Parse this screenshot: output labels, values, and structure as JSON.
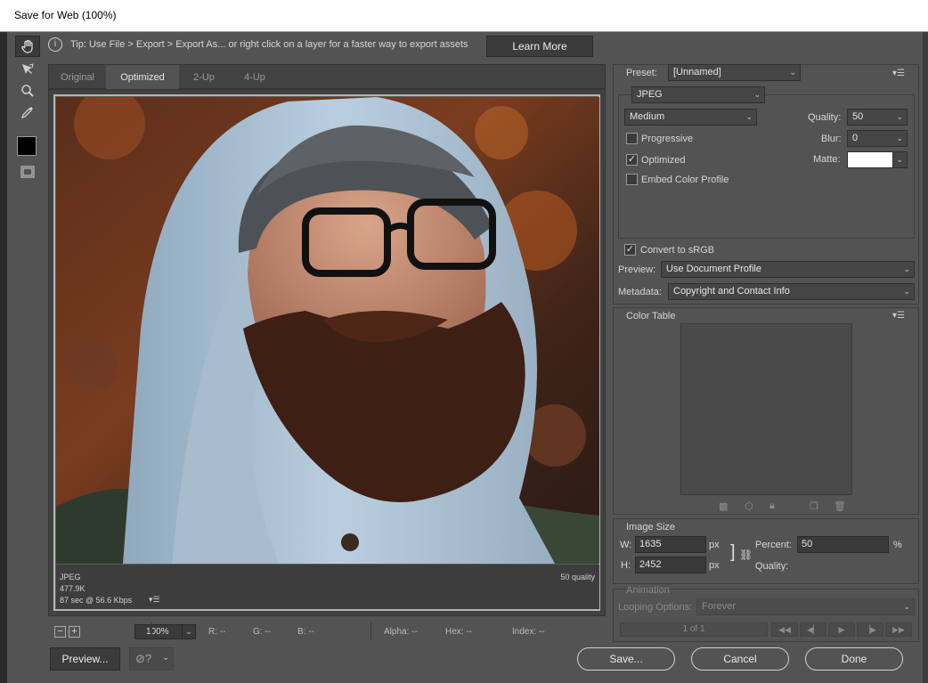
{
  "window": {
    "title": "Save for Web (100%)"
  },
  "tip": {
    "icon": "info-icon",
    "text": "Tip: Use File > Export > Export As...  or right click on a layer for a faster way to export assets",
    "learn_more": "Learn More"
  },
  "tools": [
    "hand-tool-icon",
    "slice-select-tool-icon",
    "zoom-tool-icon",
    "eyedropper-tool-icon",
    "eyedropper-color-swatch",
    "toggle-slices-icon"
  ],
  "tabs": [
    {
      "label": "Original",
      "active": false
    },
    {
      "label": "Optimized",
      "active": true
    },
    {
      "label": "2-Up",
      "active": false
    },
    {
      "label": "4-Up",
      "active": false
    }
  ],
  "image_info": {
    "format": "JPEG",
    "size": "477.9K",
    "time": "87 sec @ 56.6 Kbps",
    "quality": "50 quality"
  },
  "status": {
    "zoom": "100%",
    "r": "R: --",
    "g": "G: --",
    "b": "B: --",
    "alpha": "Alpha: --",
    "hex": "Hex: --",
    "index": "Index: --"
  },
  "preset": {
    "label": "Preset:",
    "value": "[Unnamed]",
    "format": "JPEG",
    "quality_preset": "Medium",
    "quality_label": "Quality:",
    "quality_value": "50",
    "blur_label": "Blur:",
    "blur_value": "0",
    "matte_label": "Matte:",
    "matte_color": "#ffffff",
    "progressive": {
      "label": "Progressive",
      "checked": false
    },
    "optimized": {
      "label": "Optimized",
      "checked": true
    },
    "embed_profile": {
      "label": "Embed Color Profile",
      "checked": false
    }
  },
  "color": {
    "convert_srgb": {
      "label": "Convert to sRGB",
      "checked": true
    },
    "preview_label": "Preview:",
    "preview_value": "Use Document Profile",
    "metadata_label": "Metadata:",
    "metadata_value": "Copyright and Contact Info"
  },
  "color_table": {
    "title": "Color Table"
  },
  "image_size": {
    "title": "Image Size",
    "w_label": "W:",
    "w_value": "1635",
    "h_label": "H:",
    "h_value": "2452",
    "unit": "px",
    "percent_label": "Percent:",
    "percent_value": "50",
    "percent_unit": "%",
    "quality_label": "Quality:"
  },
  "animation": {
    "title": "Animation",
    "looping_label": "Looping Options:",
    "looping_value": "Forever",
    "frame": "1 of 1"
  },
  "buttons": {
    "preview": "Preview...",
    "save": "Save...",
    "cancel": "Cancel",
    "done": "Done"
  },
  "colors": {
    "dialog_bg": "#535353",
    "panel_border": "#3e3e3e",
    "text": "#d6d6d6"
  }
}
